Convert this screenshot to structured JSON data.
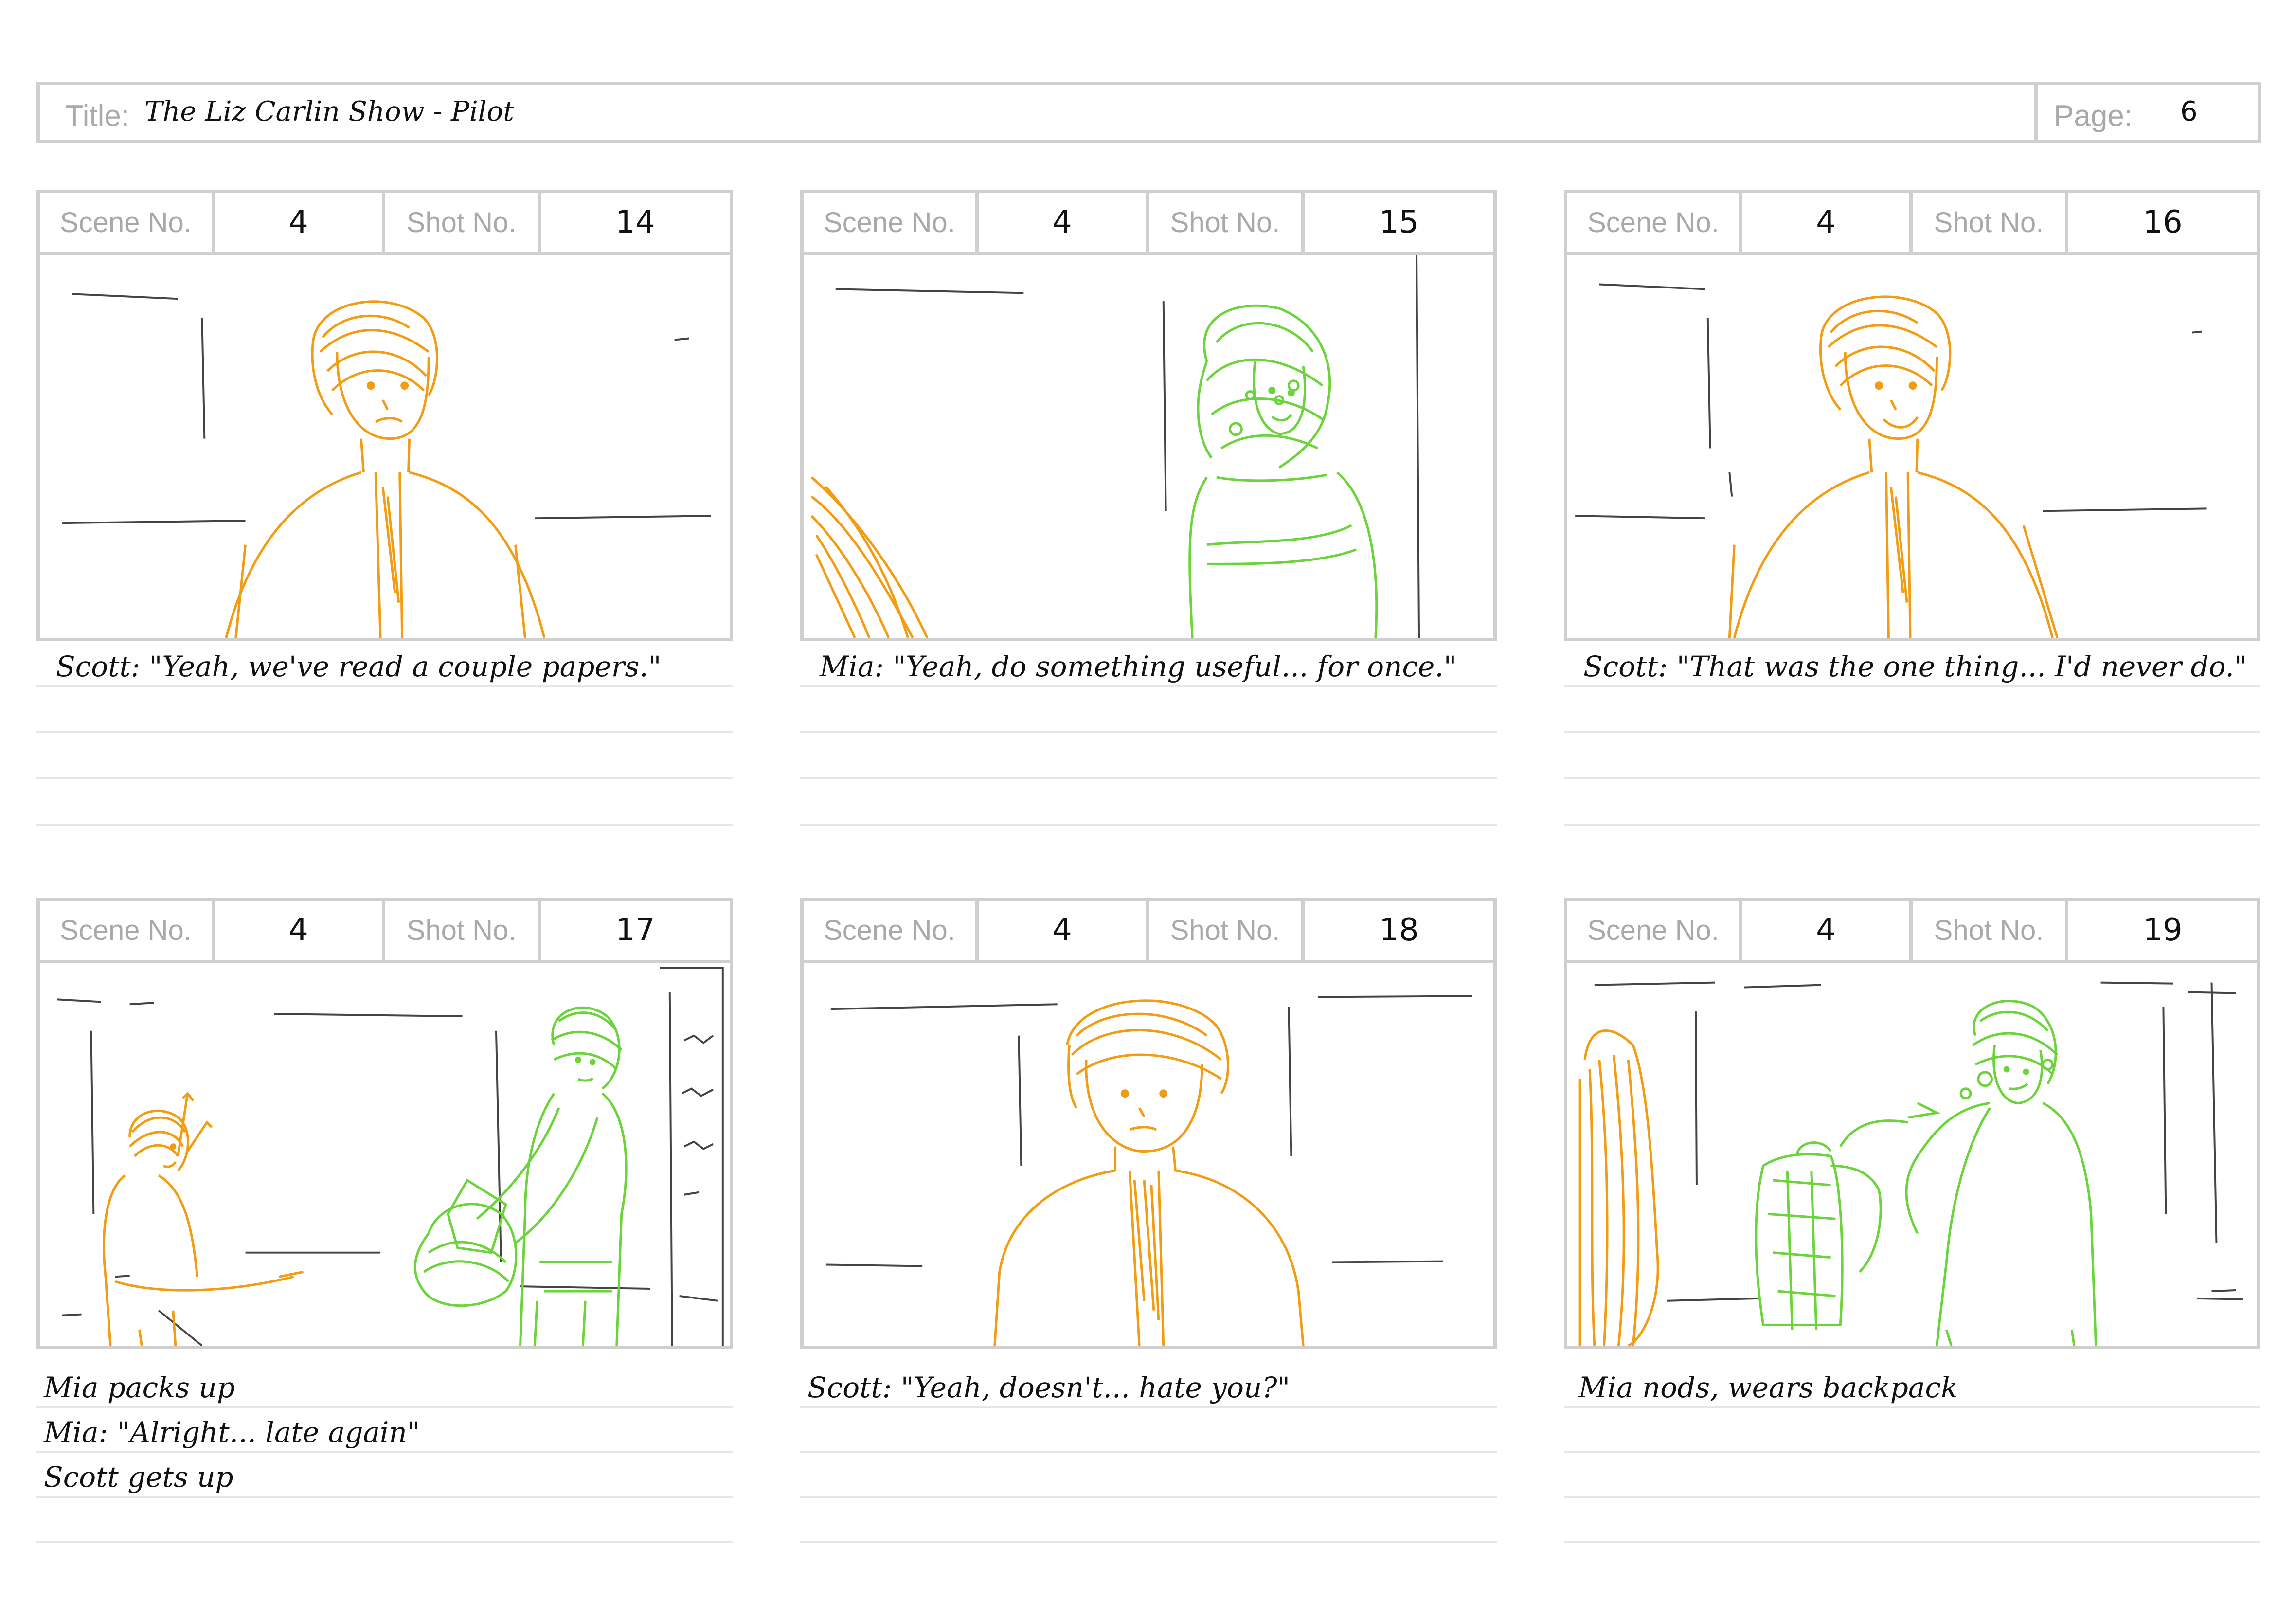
{
  "header": {
    "title_label": "Title:",
    "title_value": "The Liz Carlin Show - Pilot",
    "page_label": "Page:",
    "page_value": "6"
  },
  "panels": [
    {
      "scene_label": "Scene No.",
      "scene": "4",
      "shot_label": "Shot No.",
      "shot": "14",
      "notes": [
        "Scott: \"Yeah, we've read a couple papers.\""
      ]
    },
    {
      "scene_label": "Scene No.",
      "scene": "4",
      "shot_label": "Shot No.",
      "shot": "15",
      "notes": [
        "Mia: \"Yeah, do something useful... for once.\""
      ]
    },
    {
      "scene_label": "Scene No.",
      "scene": "4",
      "shot_label": "Shot No.",
      "shot": "16",
      "notes": [
        "Scott: \"That was the one thing... I'd never do.\""
      ]
    },
    {
      "scene_label": "Scene No.",
      "scene": "4",
      "shot_label": "Shot No.",
      "shot": "17",
      "notes": [
        "Mia packs up",
        "Mia: \"Alright... late again\"",
        "Scott gets up"
      ]
    },
    {
      "scene_label": "Scene No.",
      "scene": "4",
      "shot_label": "Shot No.",
      "shot": "18",
      "notes": [
        "Scott: \"Yeah, doesn't... hate you?\""
      ]
    },
    {
      "scene_label": "Scene No.",
      "scene": "4",
      "shot_label": "Shot No.",
      "shot": "19",
      "notes": [
        "Mia nods, wears backpack"
      ]
    }
  ],
  "colors": {
    "scott": "#f39c12",
    "mia": "#6bd43a",
    "frame": "#cfcfcf",
    "sketch": "#444444"
  }
}
